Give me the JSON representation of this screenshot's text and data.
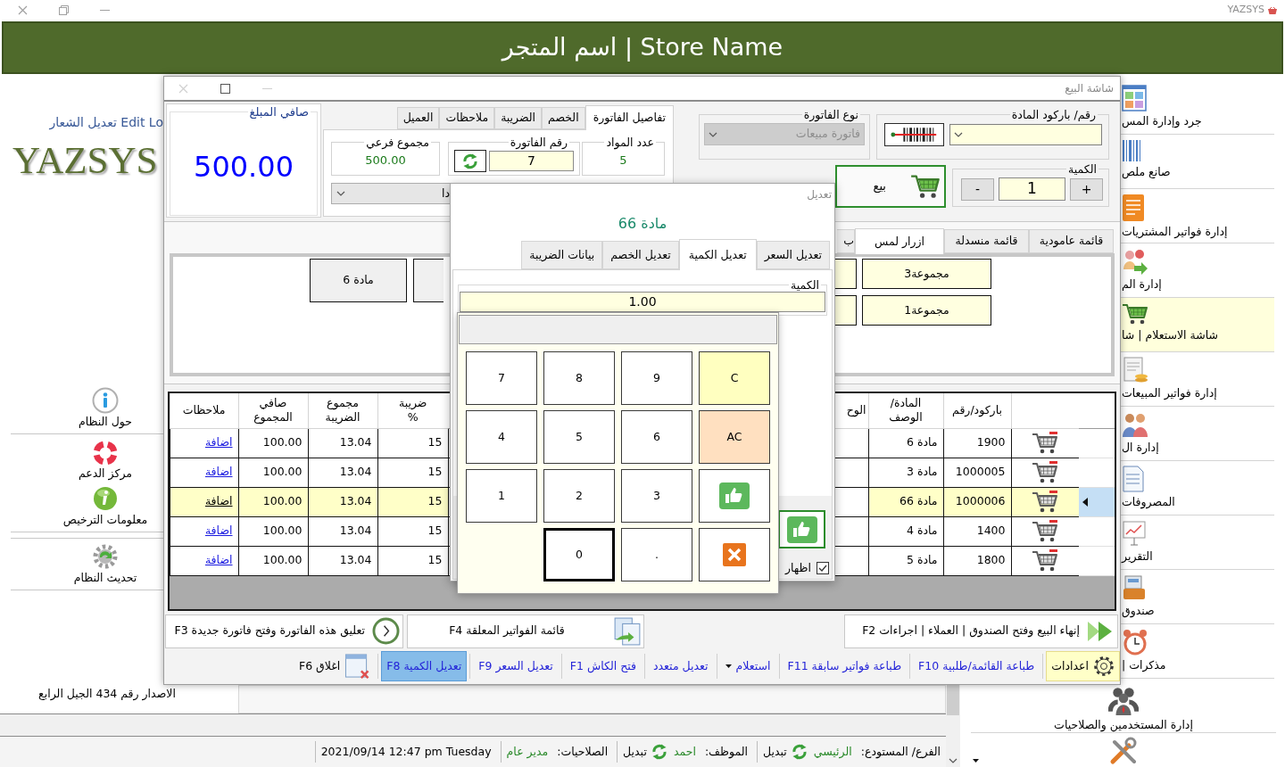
{
  "app": {
    "title": "YAZSYS"
  },
  "header": {
    "title": "اسم المتجر | Store Name"
  },
  "left_panel": {
    "logo_link": "تعديل الشعار Edit Lo",
    "logo": "YAZSYS",
    "items": [
      {
        "kind": "about",
        "label": "حول النظام"
      },
      {
        "kind": "support",
        "label": "مركز الدعم"
      },
      {
        "kind": "license",
        "label": "معلومات الترخيص"
      },
      {
        "kind": "update",
        "label": "تحديث النظام"
      }
    ],
    "version": "الاصدار رقم 434 الجيل الرابع"
  },
  "side_menu": {
    "items": [
      {
        "kind": "inventory",
        "label": "جرد وإدارة المس",
        "cut": true,
        "selected": false
      },
      {
        "kind": "labels",
        "label": "صانع ملص",
        "cut": true,
        "selected": false
      },
      {
        "kind": "purchases",
        "label": "إدارة فواتير المشتريات",
        "cut": true,
        "selected": false
      },
      {
        "kind": "suppliers",
        "label": "إدارة الم",
        "cut": true,
        "selected": false
      },
      {
        "kind": "inquiry",
        "label": "شاشة الاستعلام | شا",
        "cut": true,
        "selected": true
      },
      {
        "kind": "sales",
        "label": "إدارة فواتير المبيعات",
        "cut": true,
        "selected": false
      },
      {
        "kind": "customers",
        "label": "إدارة ال",
        "cut": true,
        "selected": false
      },
      {
        "kind": "expenses",
        "label": "المصروفات",
        "cut": true,
        "selected": false
      },
      {
        "kind": "reports",
        "label": "التقرير",
        "cut": true,
        "selected": false
      },
      {
        "kind": "cashbox",
        "label": "صندوق",
        "cut": true,
        "selected": false
      },
      {
        "kind": "notes",
        "label": "مذكرات |",
        "cut": true,
        "selected": false
      },
      {
        "kind": "users",
        "label": "إدارة المستخدمين والصلاحيات",
        "cut": false,
        "selected": false
      },
      {
        "kind": "tools",
        "cut": false,
        "selected": false
      }
    ]
  },
  "sale_window": {
    "title": "شاشة البيع",
    "barcode": {
      "label": "رقم/ باركود المادة"
    },
    "invoice_type": {
      "label": "نوع الفاتورة",
      "value": "فاتورة مبيعات",
      "disabled": true
    },
    "quantity": {
      "label": "الكمية",
      "plus": "+",
      "value": "1",
      "minus": "-"
    },
    "sell_button": {
      "label": "بيع"
    },
    "invoice_tabs": [
      {
        "label": "تفاصيل الفاتورة",
        "selected": true
      },
      {
        "label": "الخصم",
        "selected": false
      },
      {
        "label": "الضريبة",
        "selected": false
      },
      {
        "label": "ملاحظات",
        "selected": false
      },
      {
        "label": "العميل",
        "selected": false
      }
    ],
    "items_count": {
      "label": "عدد المواد",
      "value": "5"
    },
    "invoice_number": {
      "label": "رقم الفاتورة",
      "value": "7"
    },
    "subtotal": {
      "label": "مجموع فرعي",
      "value": "500.00"
    },
    "customer_select": {
      "value": "دا"
    },
    "net_amount": {
      "label": "صافي المبلغ",
      "value": "500.00"
    },
    "product_tabs": [
      {
        "label": "قائمة عامودية",
        "selected": false,
        "cut": false
      },
      {
        "label": "قائمة منسدلة",
        "selected": false,
        "cut": false
      },
      {
        "label": "ازرار لمس",
        "selected": true,
        "cut": false
      },
      {
        "label": "ب",
        "selected": false,
        "cut": true
      }
    ],
    "touch_buttons": [
      [
        {
          "kind": "group",
          "label": "مجموعة3",
          "cut": false
        },
        {
          "kind": "group",
          "label": "مجموعة1",
          "cut": false
        }
      ],
      [
        {
          "kind": "group",
          "cut": true
        },
        {
          "kind": "group",
          "cut": true
        }
      ],
      [
        {
          "kind": "item",
          "cut": true
        }
      ],
      [
        {
          "kind": "item",
          "label": "مادة 6",
          "cut": false
        }
      ]
    ],
    "table": {
      "columns": {
        "barcode": "باركود/رقم",
        "item": "المادة/ الوصف",
        "unit": "الوح",
        "tax_percent": "ضريبة %",
        "tax_total": "مجموع الضريبة",
        "net_total": "صافي المجموع",
        "notes": "ملاحظات"
      },
      "rows": [
        {
          "barcode": "1900",
          "item": "مادة 6",
          "tax_percent": "15",
          "tax_total": "13.04",
          "net_total": "100.00",
          "notes": "اضافة",
          "selected": false
        },
        {
          "barcode": "1000005",
          "item": "مادة 3",
          "tax_percent": "15",
          "tax_total": "13.04",
          "net_total": "100.00",
          "notes": "اضافة",
          "selected": false
        },
        {
          "barcode": "1000006",
          "item": "مادة 66",
          "tax_percent": "15",
          "tax_total": "13.04",
          "net_total": "100.00",
          "notes": "اضافة",
          "selected": true
        },
        {
          "barcode": "1400",
          "item": "مادة 4",
          "tax_percent": "15",
          "tax_total": "13.04",
          "net_total": "100.00",
          "notes": "اضافة",
          "selected": false
        },
        {
          "barcode": "1800",
          "item": "مادة 5",
          "tax_percent": "15",
          "tax_total": "13.04",
          "net_total": "100.00",
          "notes": "اضافة",
          "selected": false
        }
      ]
    },
    "actions": [
      {
        "kind": "finish",
        "label": "إنهاء البيع وفتح الصندوق | العملاء | اجراءات F2"
      },
      {
        "kind": "held_list",
        "label": "قائمة الفواتير المعلقة F4"
      },
      {
        "kind": "hold",
        "label": "تعليق هذه الفاتورة وفتح فاتورة جديدة F3"
      }
    ],
    "toolbar": [
      {
        "kind": "settings",
        "label": "اعدادات",
        "selected": false,
        "highlighted": true
      },
      {
        "kind": "link",
        "label": "طباعة القائمة/طلبية F10",
        "selected": false,
        "highlighted": false
      },
      {
        "kind": "link",
        "label": "طباعة فواتير سابقة F11",
        "selected": false,
        "highlighted": false
      },
      {
        "kind": "dropdown",
        "label": "استعلام",
        "selected": false,
        "highlighted": false
      },
      {
        "kind": "link",
        "label": "تعديل متعدد",
        "selected": false,
        "highlighted": false
      },
      {
        "kind": "link",
        "label": "فتح الكاش F1",
        "selected": false,
        "highlighted": false
      },
      {
        "kind": "link",
        "label": "تعديل السعر F9",
        "selected": false,
        "highlighted": false
      },
      {
        "kind": "link",
        "label": "تعديل الكمية F8",
        "selected": true,
        "highlighted": false
      },
      {
        "kind": "close",
        "label": "اغلاق F6",
        "selected": false,
        "highlighted": false
      }
    ]
  },
  "edit_dialog": {
    "title": "تعديل",
    "item": "مادة 66",
    "tabs": [
      {
        "label": "تعديل السعر",
        "selected": false
      },
      {
        "label": "تعديل الكمية",
        "selected": true
      },
      {
        "label": "تعديل الخصم",
        "selected": false
      },
      {
        "label": "بيانات الضريبة",
        "selected": false
      }
    ],
    "quantity": {
      "label": "الكمية",
      "value": "1.00"
    },
    "show_option": {
      "label": "اظهار",
      "checked": true
    }
  },
  "keypad": {
    "keys": [
      {
        "kind": "clear",
        "label": "C",
        "focused": false
      },
      {
        "kind": "digit",
        "label": "9",
        "focused": false
      },
      {
        "kind": "digit",
        "label": "8",
        "focused": false
      },
      {
        "kind": "digit",
        "label": "7",
        "focused": false
      },
      {
        "kind": "all_clear",
        "label": "AC",
        "focused": false
      },
      {
        "kind": "digit",
        "label": "6",
        "focused": false
      },
      {
        "kind": "digit",
        "label": "5",
        "focused": false
      },
      {
        "kind": "digit",
        "label": "4",
        "focused": false
      },
      {
        "kind": "ok",
        "focused": false
      },
      {
        "kind": "digit",
        "label": "3",
        "focused": false
      },
      {
        "kind": "digit",
        "label": "2",
        "focused": false
      },
      {
        "kind": "digit",
        "label": "1",
        "focused": false
      },
      {
        "kind": "cancel",
        "focused": false
      },
      {
        "kind": "digit",
        "label": ".",
        "focused": false
      },
      {
        "kind": "digit",
        "label": "0",
        "focused": true
      }
    ]
  },
  "status_bar": {
    "groups": [
      {
        "label": "الفرع/ المستودع:",
        "value": "الرئيسي",
        "action": "تبديل"
      },
      {
        "label": "الموظف:",
        "value": "احمد",
        "action": "تبديل"
      },
      {
        "label": "الصلاحيات:",
        "value": "مدير عام"
      }
    ],
    "datetime": "2021/09/14 12:47 pm Tuesday"
  }
}
